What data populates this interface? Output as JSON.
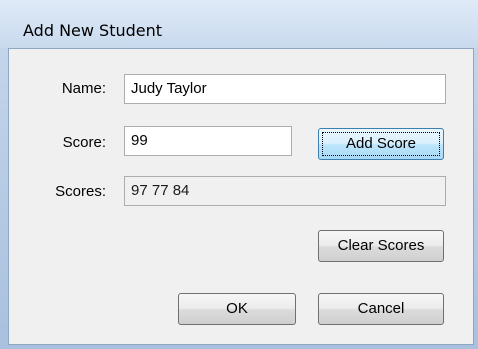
{
  "window": {
    "title": "Add New Student"
  },
  "form": {
    "name_label": "Name:",
    "name_value": "Judy Taylor",
    "score_label": "Score:",
    "score_value": "99",
    "scores_label": "Scores:",
    "scores_value": "97 77 84"
  },
  "buttons": {
    "add_score": "Add Score",
    "clear_scores": "Clear Scores",
    "ok": "OK",
    "cancel": "Cancel"
  }
}
